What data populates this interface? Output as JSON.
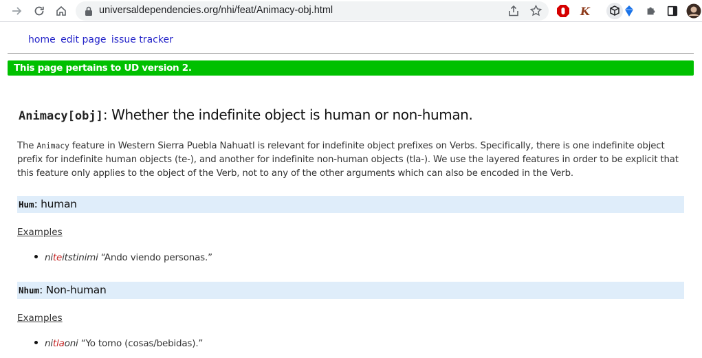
{
  "browser": {
    "url": "universaldependencies.org/nhi/feat/Animacy-obj.html",
    "buttons": [
      "forward-icon",
      "reload-icon",
      "home-icon"
    ],
    "extensions": [
      "ublock-icon",
      "kodable-icon",
      "box-icon",
      "diamond-icon",
      "puzzle-icon",
      "sidepanel-icon",
      "profile-avatar"
    ]
  },
  "nav": {
    "home": "home",
    "edit": "edit page",
    "issues": "issue tracker"
  },
  "banner": {
    "text": "This page pertains to UD version 2.",
    "color": "#00c000"
  },
  "title": {
    "code": "Animacy[obj]",
    "text": ": Whether the indefinite object is human or non-human."
  },
  "description": {
    "part1": "The ",
    "code": "Animacy",
    "part2": " feature in Western Sierra Puebla Nahuatl is relevant for indefinite object prefixes on Verbs. Specifically, there is one indefinite object prefix for indefinite human objects (te-), and another for indefinite non-human objects (tla-). We use the layered features in order to be explicit that this feature only applies to the object of the Verb, not to any of the other arguments which can also be encoded in the Verb."
  },
  "sections": [
    {
      "code": "Hum",
      "label": ": human",
      "examples_label": "Examples",
      "example": {
        "pre": "ni",
        "highlight": "te",
        "post": "itstinimi",
        "gloss": " “Ando viendo personas.”"
      }
    },
    {
      "code": "Nhum",
      "label": ": Non-human",
      "examples_label": "Examples",
      "example": {
        "pre": "ni",
        "highlight": "tla",
        "post": "oni",
        "gloss": " “Yo tomo (cosas/bebidas).”"
      }
    }
  ]
}
